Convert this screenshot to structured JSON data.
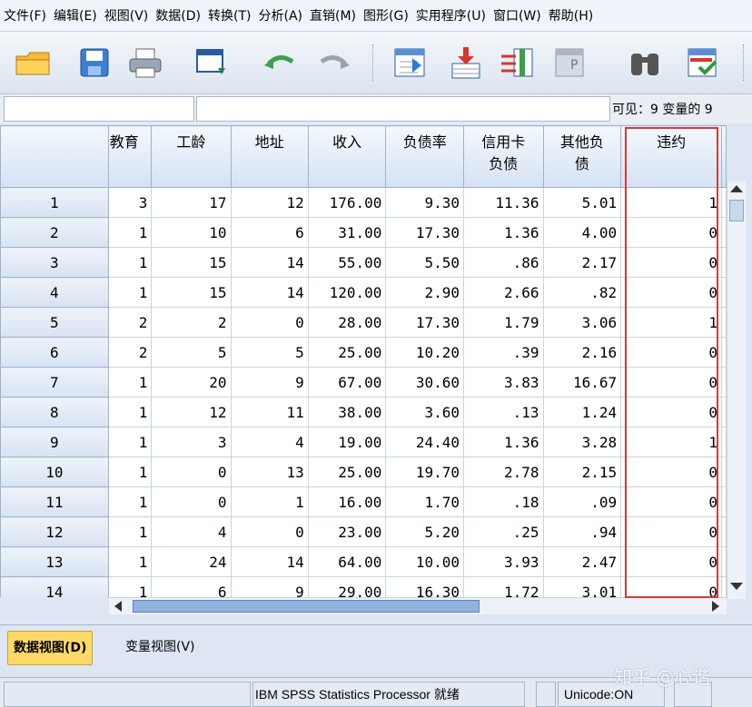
{
  "menu": [
    "文件(F)",
    "编辑(E)",
    "视图(V)",
    "数据(D)",
    "转换(T)",
    "分析(A)",
    "直销(M)",
    "图形(G)",
    "实用程序(U)",
    "窗口(W)",
    "帮助(H)"
  ],
  "toolbar": {
    "icons": [
      "open-folder-icon",
      "save-icon",
      "print-icon",
      "dialog-recall-icon",
      "undo-icon",
      "redo-icon",
      "go-to-case-icon",
      "insert-cases-icon",
      "insert-variable-icon",
      "split-file-icon",
      "find-icon",
      "value-labels-icon"
    ]
  },
  "infobar": {
    "cell_ref": "",
    "cell_value": "",
    "visible_vars": "可见：9 变量的 9"
  },
  "grid": {
    "columns": [
      "教育",
      "工龄",
      "地址",
      "收入",
      "负债率",
      "信用卡负债",
      "其他负债",
      "违约"
    ],
    "column_lines": [
      [
        "教育"
      ],
      [
        "工龄"
      ],
      [
        "地址"
      ],
      [
        "收入"
      ],
      [
        "负债率"
      ],
      [
        "信用卡",
        "负债"
      ],
      [
        "其他负",
        "债"
      ],
      [
        "违约"
      ]
    ],
    "rows": [
      {
        "id": "1",
        "values": [
          "3",
          "17",
          "12",
          "176.00",
          "9.30",
          "11.36",
          "5.01",
          "1"
        ]
      },
      {
        "id": "2",
        "values": [
          "1",
          "10",
          "6",
          "31.00",
          "17.30",
          "1.36",
          "4.00",
          "0"
        ]
      },
      {
        "id": "3",
        "values": [
          "1",
          "15",
          "14",
          "55.00",
          "5.50",
          ".86",
          "2.17",
          "0"
        ]
      },
      {
        "id": "4",
        "values": [
          "1",
          "15",
          "14",
          "120.00",
          "2.90",
          "2.66",
          ".82",
          "0"
        ]
      },
      {
        "id": "5",
        "values": [
          "2",
          "2",
          "0",
          "28.00",
          "17.30",
          "1.79",
          "3.06",
          "1"
        ]
      },
      {
        "id": "6",
        "values": [
          "2",
          "5",
          "5",
          "25.00",
          "10.20",
          ".39",
          "2.16",
          "0"
        ]
      },
      {
        "id": "7",
        "values": [
          "1",
          "20",
          "9",
          "67.00",
          "30.60",
          "3.83",
          "16.67",
          "0"
        ]
      },
      {
        "id": "8",
        "values": [
          "1",
          "12",
          "11",
          "38.00",
          "3.60",
          ".13",
          "1.24",
          "0"
        ]
      },
      {
        "id": "9",
        "values": [
          "1",
          "3",
          "4",
          "19.00",
          "24.40",
          "1.36",
          "3.28",
          "1"
        ]
      },
      {
        "id": "10",
        "values": [
          "1",
          "0",
          "13",
          "25.00",
          "19.70",
          "2.78",
          "2.15",
          "0"
        ]
      },
      {
        "id": "11",
        "values": [
          "1",
          "0",
          "1",
          "16.00",
          "1.70",
          ".18",
          ".09",
          "0"
        ]
      },
      {
        "id": "12",
        "values": [
          "1",
          "4",
          "0",
          "23.00",
          "5.20",
          ".25",
          ".94",
          "0"
        ]
      },
      {
        "id": "13",
        "values": [
          "1",
          "24",
          "14",
          "64.00",
          "10.00",
          "3.93",
          "2.47",
          "0"
        ]
      },
      {
        "id": "14",
        "values": [
          "1",
          "6",
          "9",
          "29.00",
          "16.30",
          "1.72",
          "3.01",
          "0"
        ]
      }
    ],
    "highlight_column": "违约",
    "highlight_color": "#d33a3a"
  },
  "tabs": {
    "data_view": "数据视图(D)",
    "variable_view": "变量视图(V)",
    "active_color": "#ffd968"
  },
  "status": {
    "processor": "IBM SPSS Statistics Processor 就绪",
    "unicode": "Unicode:ON"
  },
  "watermark": "知乎 @心谐"
}
